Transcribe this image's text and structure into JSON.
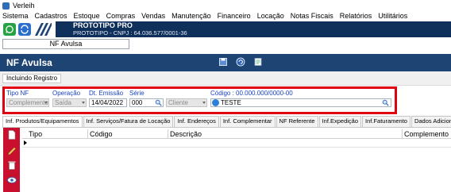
{
  "window": {
    "title": "Verleih"
  },
  "menu": [
    "Sistema",
    "Cadastros",
    "Estoque",
    "Compras",
    "Vendas",
    "Manutenção",
    "Financeiro",
    "Locação",
    "Notas Fiscais",
    "Relatórios",
    "Utilitários"
  ],
  "company": {
    "name": "PROTOTIPO PRO",
    "detail": "PROTOTIPO - CNPJ : 64.036.577/0001-36"
  },
  "document_tab": "NF Avulsa",
  "form": {
    "title": "NF Avulsa",
    "status": "Incluindo Registro",
    "fields": {
      "tipo_nf": {
        "label": "Tipo NF",
        "value": "Complemento"
      },
      "operacao": {
        "label": "Operação",
        "value": "Saída"
      },
      "dt_emissao": {
        "label": "Dt. Emissão",
        "value": "14/04/2022"
      },
      "serie": {
        "label": "Série",
        "value": "000"
      },
      "cliente": {
        "value": "Cliente"
      },
      "codigo": {
        "label": "Código : 00.000.000/0000-00",
        "value": "TESTE"
      }
    }
  },
  "tabs": [
    "Inf. Produtos/Equipamentos",
    "Inf. Serviços/Fatura de Locação",
    "Inf. Endereços",
    "Inf. Complementar",
    "NF Referente",
    "Inf.Expedição",
    "Inf.Faturamento",
    "Dados Adicionais"
  ],
  "grid": {
    "columns": [
      "Tipo",
      "Código",
      "Descrição",
      "Complemento"
    ]
  },
  "colors": {
    "header_blue": "#1d4473",
    "highlight_red": "#e0000f",
    "sidebar_red": "#c8102e",
    "label_blue": "#1a44c0"
  },
  "icons": [
    "app-icon",
    "whatsapp-icon",
    "sync-icon",
    "logo-icon",
    "save-icon",
    "undo-icon",
    "edit-icon",
    "new-doc-icon",
    "pencil-icon",
    "trash-icon",
    "view-icon",
    "search-icon",
    "globe-icon"
  ]
}
